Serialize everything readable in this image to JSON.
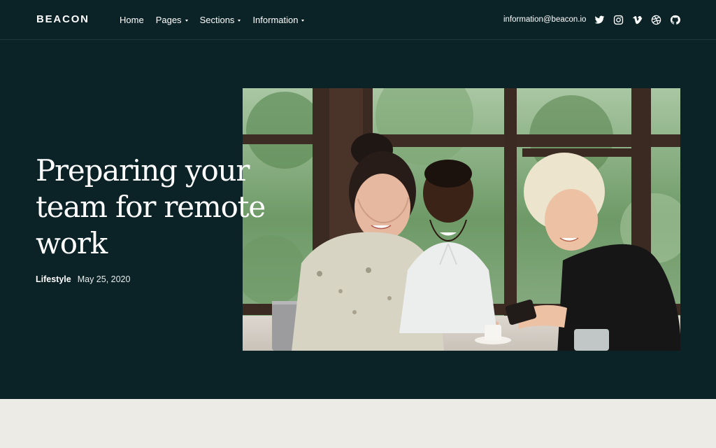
{
  "brand": {
    "name": "BEACON"
  },
  "nav": {
    "items": [
      {
        "label": "Home",
        "has_dropdown": false
      },
      {
        "label": "Pages",
        "has_dropdown": true
      },
      {
        "label": "Sections",
        "has_dropdown": true
      },
      {
        "label": "Information",
        "has_dropdown": true
      }
    ],
    "email": "information@beacon.io",
    "social": [
      "twitter-icon",
      "instagram-icon",
      "vimeo-icon",
      "dribbble-icon",
      "github-icon"
    ]
  },
  "hero": {
    "title": "Preparing your team for remote work",
    "category": "Lifestyle",
    "date": "May 25, 2020",
    "image_alt": "three-women-looking-at-phone-photo"
  },
  "colors": {
    "background": "#0b2327",
    "text": "#ffffff",
    "lower_band": "#edebe6"
  }
}
